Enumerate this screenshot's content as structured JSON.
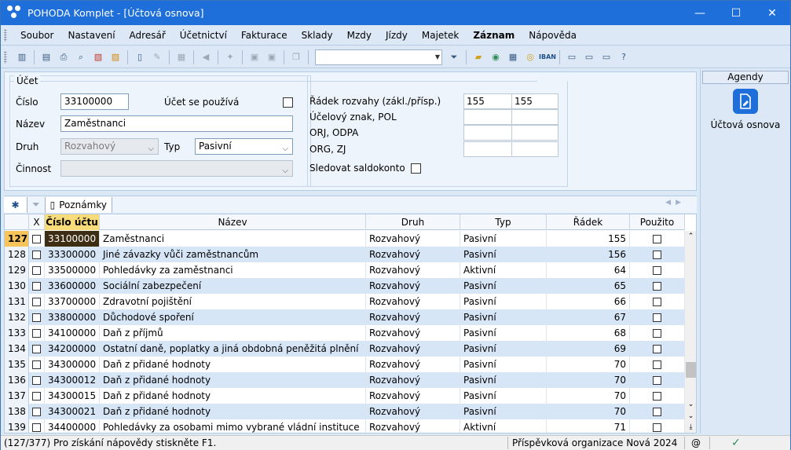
{
  "window": {
    "title": "POHODA Komplet - [Účtová osnova]",
    "controls": {
      "minimize": "—",
      "maximize": "☐",
      "close": "✕"
    }
  },
  "menu": [
    "Soubor",
    "Nastavení",
    "Adresář",
    "Účetnictví",
    "Fakturace",
    "Sklady",
    "Mzdy",
    "Jízdy",
    "Majetek",
    "Záznam",
    "Nápověda"
  ],
  "toolbar": {
    "search_value": "",
    "iban_label": "IBAN"
  },
  "form": {
    "group_title": "Účet",
    "cislo_label": "Číslo",
    "cislo_value": "33100000",
    "pouziva_label": "Účet se používá",
    "nazev_label": "Název",
    "nazev_value": "Zaměstnanci",
    "druh_label": "Druh",
    "druh_value": "Rozvahový",
    "typ_label": "Typ",
    "typ_value": "Pasivní",
    "cinnost_label": "Činnost",
    "cinnost_value": "",
    "radek_label": "Řádek rozvahy (zákl./přísp.)",
    "radek_zakl": "155",
    "radek_prisp": "155",
    "ucelovy_label": "Účelový znak, POL",
    "orj_label": "ORJ, ODPA",
    "org_label": "ORG, ZJ",
    "saldo_label": "Sledovat saldokonto"
  },
  "tabs": {
    "star": "✱",
    "notes": "Poznámky"
  },
  "grid": {
    "headers": {
      "x": "X",
      "cislo": "Číslo účtu",
      "nazev": "Název",
      "druh": "Druh",
      "typ": "Typ",
      "radek": "Řádek",
      "pouzito": "Použito"
    },
    "rows": [
      {
        "n": "127",
        "cislo": "33100000",
        "nazev": "Zaměstnanci",
        "druh": "Rozvahový",
        "typ": "Pasivní",
        "radek": "155"
      },
      {
        "n": "128",
        "cislo": "33300000",
        "nazev": "Jiné závazky vůči zaměstnancům",
        "druh": "Rozvahový",
        "typ": "Pasivní",
        "radek": "156"
      },
      {
        "n": "129",
        "cislo": "33500000",
        "nazev": "Pohledávky za zaměstnanci",
        "druh": "Rozvahový",
        "typ": "Aktivní",
        "radek": "64"
      },
      {
        "n": "130",
        "cislo": "33600000",
        "nazev": "Sociální zabezpečení",
        "druh": "Rozvahový",
        "typ": "Pasivní",
        "radek": "65"
      },
      {
        "n": "131",
        "cislo": "33700000",
        "nazev": "Zdravotní pojištění",
        "druh": "Rozvahový",
        "typ": "Pasivní",
        "radek": "66"
      },
      {
        "n": "132",
        "cislo": "33800000",
        "nazev": "Důchodové spoření",
        "druh": "Rozvahový",
        "typ": "Pasivní",
        "radek": "67"
      },
      {
        "n": "133",
        "cislo": "34100000",
        "nazev": "Daň z příjmů",
        "druh": "Rozvahový",
        "typ": "Pasivní",
        "radek": "68"
      },
      {
        "n": "134",
        "cislo": "34200000",
        "nazev": "Ostatní daně, poplatky a jiná obdobná peněžitá plnění",
        "druh": "Rozvahový",
        "typ": "Pasivní",
        "radek": "69"
      },
      {
        "n": "135",
        "cislo": "34300000",
        "nazev": "Daň z přidané hodnoty",
        "druh": "Rozvahový",
        "typ": "Pasivní",
        "radek": "70"
      },
      {
        "n": "136",
        "cislo": "34300012",
        "nazev": "Daň z přidané hodnoty",
        "druh": "Rozvahový",
        "typ": "Pasivní",
        "radek": "70"
      },
      {
        "n": "137",
        "cislo": "34300015",
        "nazev": "Daň z přidané hodnoty",
        "druh": "Rozvahový",
        "typ": "Pasivní",
        "radek": "70"
      },
      {
        "n": "138",
        "cislo": "34300021",
        "nazev": "Daň z přidané hodnoty",
        "druh": "Rozvahový",
        "typ": "Pasivní",
        "radek": "70"
      },
      {
        "n": "139",
        "cislo": "34400000",
        "nazev": "Pohledávky za osobami mimo vybrané vládní instituce",
        "druh": "Rozvahový",
        "typ": "Aktivní",
        "radek": "71"
      }
    ]
  },
  "status": {
    "left": "(127/377) Pro získání nápovědy stiskněte F1.",
    "org": "Příspěvková organizace Nová 2024",
    "at": "@"
  },
  "agendy": {
    "title": "Agendy",
    "item": "Účtová osnova"
  },
  "colors": {
    "accent": "#1e6fd9",
    "current_row": "#f6c45a",
    "alt_row": "#d7e6f7"
  }
}
